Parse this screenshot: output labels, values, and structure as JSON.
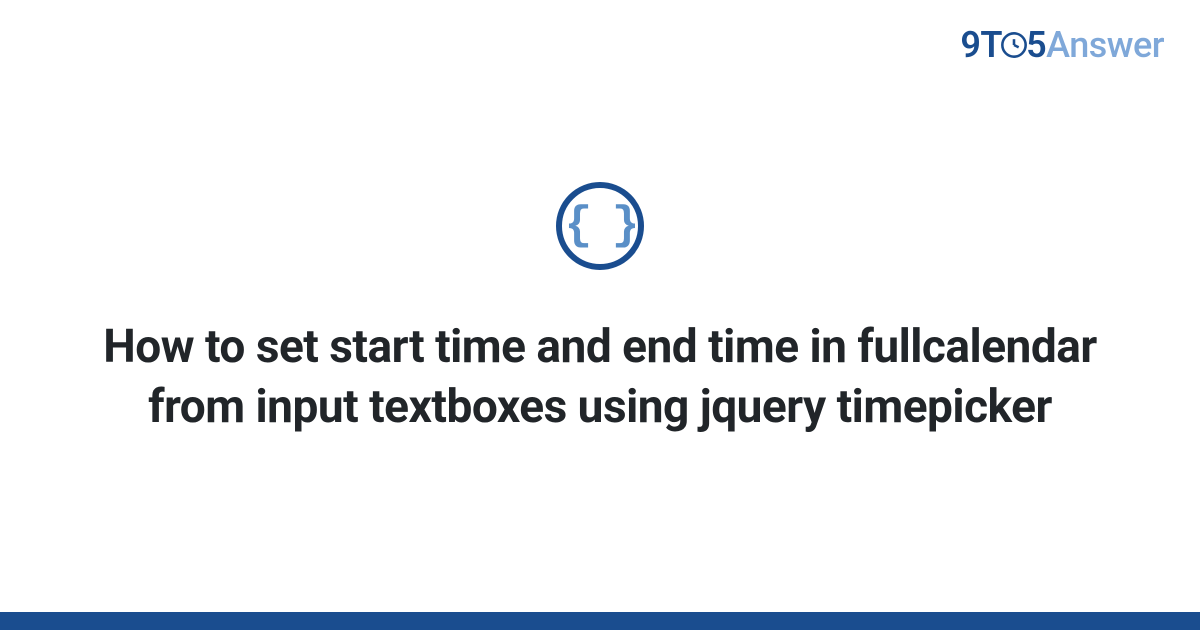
{
  "header": {
    "logo": {
      "part1": "9T",
      "part2": "5",
      "part3": "Answer"
    }
  },
  "main": {
    "icon_content": "{ }",
    "title": "How to set start time and end time in fullcalendar from input textboxes using jquery timepicker"
  },
  "colors": {
    "primary": "#1a4d8f",
    "secondary": "#7fa8d9",
    "accent": "#5a8fc7",
    "text": "#212529"
  }
}
